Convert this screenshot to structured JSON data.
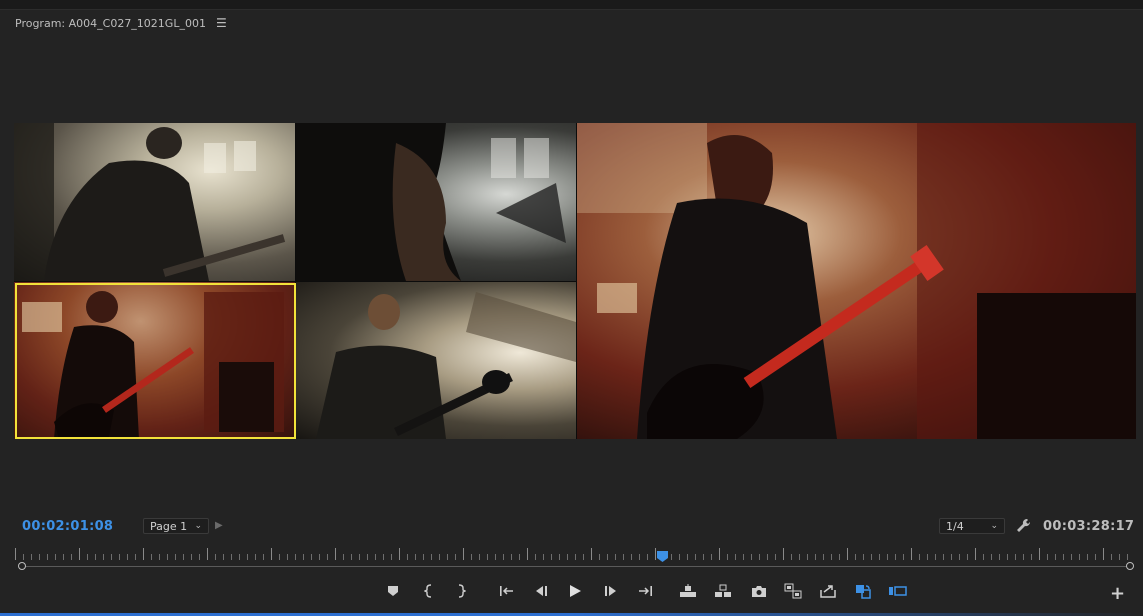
{
  "panel": {
    "title": "Program: A004_C027_1021GL_001",
    "menu_icon": "hamburger-menu-icon"
  },
  "monitor": {
    "cameras": [
      {
        "name": "camera-1"
      },
      {
        "name": "camera-2"
      },
      {
        "name": "camera-3",
        "selected": true
      },
      {
        "name": "camera-4"
      }
    ],
    "selected_color": "#f2e23a"
  },
  "timecode": {
    "current": "00:02:01:08",
    "duration": "00:03:28:17",
    "current_color": "#3d91e6"
  },
  "page_select": {
    "value": "Page 1"
  },
  "resolution_select": {
    "value": "1/4"
  },
  "transport": {
    "buttons": [
      "add-marker",
      "mark-in",
      "mark-out",
      "go-to-in",
      "step-back",
      "play",
      "step-forward",
      "go-to-out",
      "lift",
      "extract",
      "export-frame",
      "multi-camera",
      "insert",
      "toggle-proxies",
      "overwrite"
    ],
    "accent": "#3d91e6"
  }
}
